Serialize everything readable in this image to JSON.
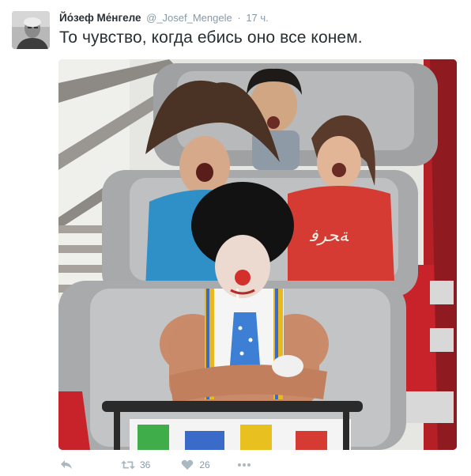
{
  "tweet": {
    "author": {
      "fullname": "Йо́зеф Ме́нгеле",
      "username": "@_Josef_Mengele",
      "time": "17 ч."
    },
    "text": "То чувство, когда ебись оно все конем.",
    "media": {
      "photo_description": "Рollercoaster photo: three screaming riders behind a calm muscular clown with crossed arms and a cigarette"
    },
    "actions": {
      "retweet_count": "36",
      "like_count": "26"
    }
  },
  "colors": {
    "text": "#292f33",
    "meta": "#8899a6",
    "icon": "#aab8c2",
    "coaster_red": "#c8232a"
  },
  "icons": [
    "reply-icon",
    "retweet-icon",
    "heart-icon",
    "more-icon"
  ]
}
